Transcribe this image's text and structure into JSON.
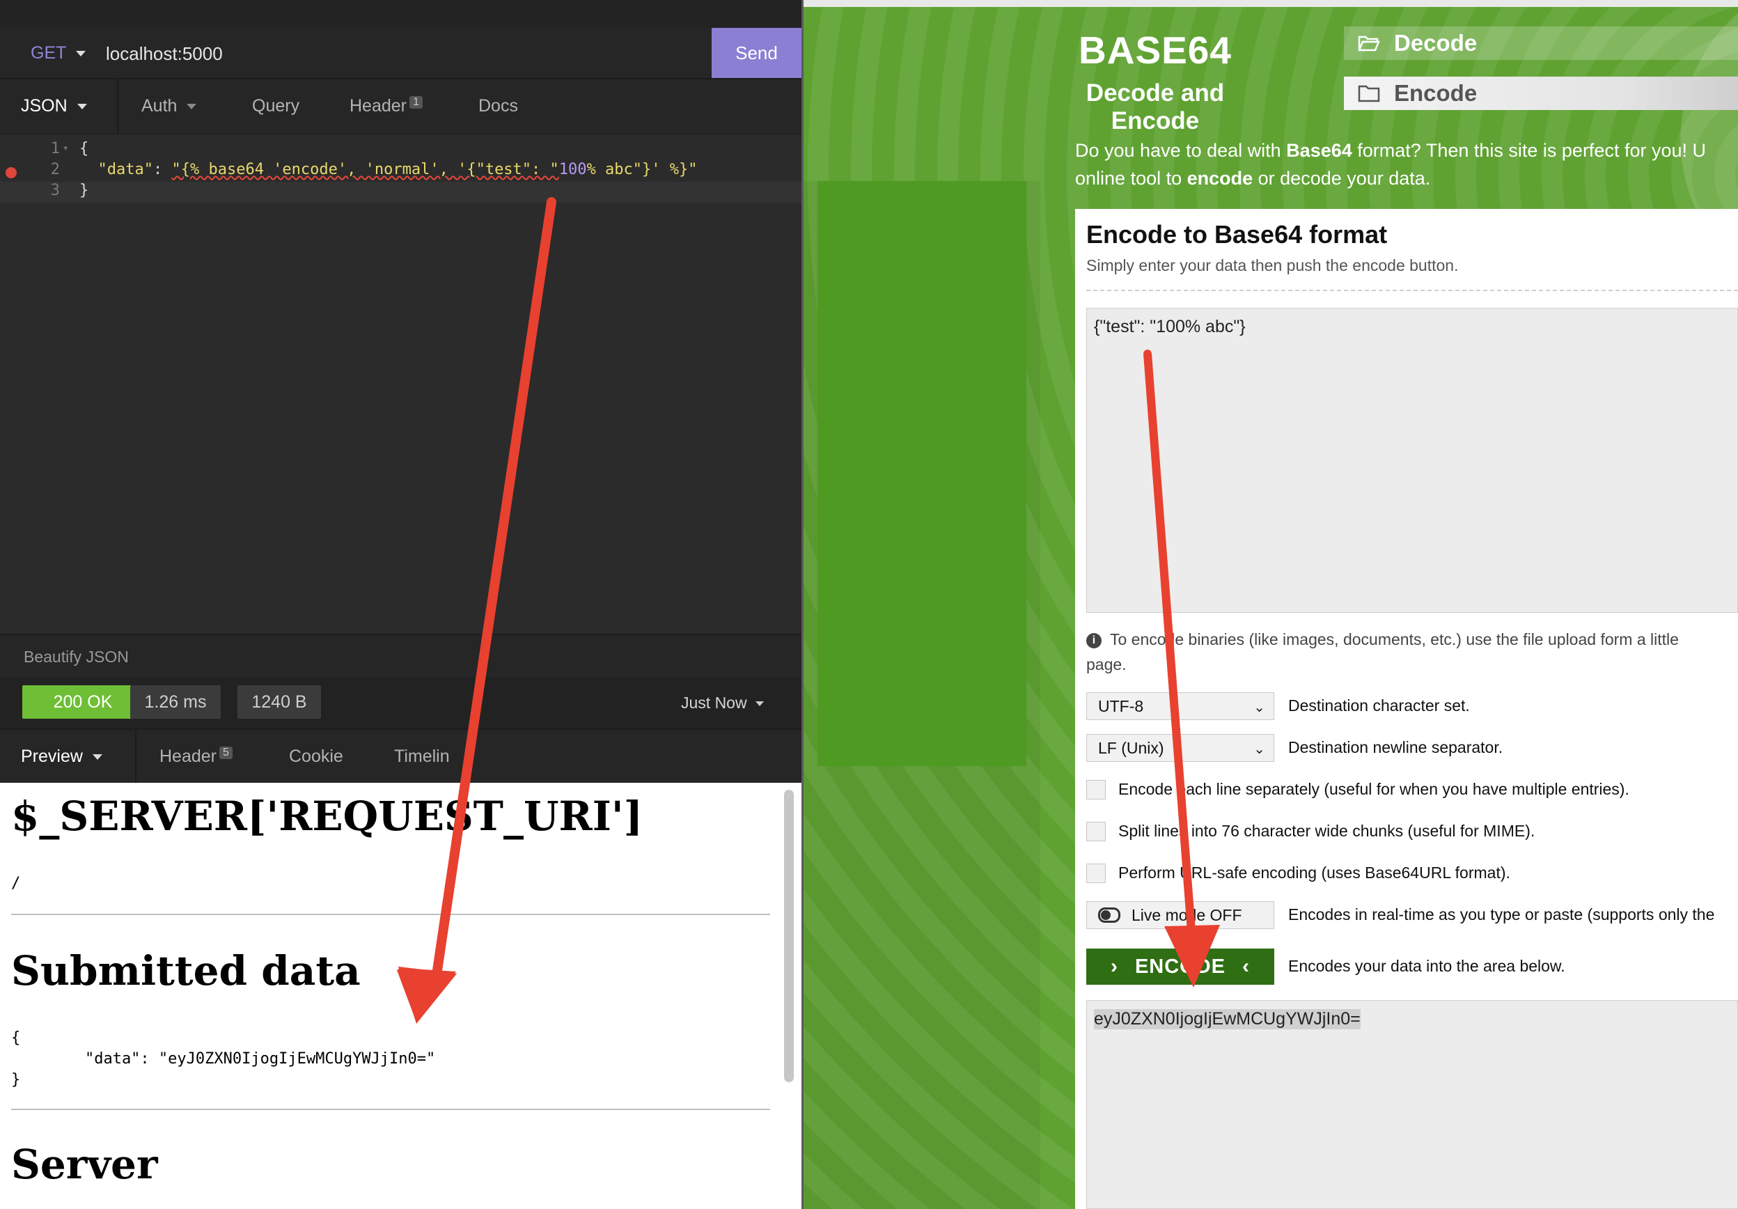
{
  "insomnia": {
    "method": "GET",
    "url": "localhost:5000",
    "send_label": "Send",
    "request_tabs": {
      "body": "JSON",
      "auth": "Auth",
      "query": "Query",
      "header": "Header",
      "header_count": "1",
      "docs": "Docs"
    },
    "editor": {
      "line_numbers": [
        "1",
        "2",
        "3"
      ],
      "line1": "{",
      "line2_key": "\"data\"",
      "line2_colon": ": ",
      "line2_val_a": "\"{% base64 'encode', 'normal', '{\"test\": \"",
      "line2_val_num": "100",
      "line2_val_b": "% abc\"}' %}\"",
      "line3": "}"
    },
    "beautify_label": "Beautify JSON",
    "status": {
      "code": "200 OK",
      "time": "1.26 ms",
      "size": "1240 B",
      "when": "Just Now"
    },
    "response_tabs": {
      "preview": "Preview",
      "header": "Header",
      "header_count": "5",
      "cookie": "Cookie",
      "timeline": "Timelin"
    },
    "preview": {
      "heading1": "$_SERVER['REQUEST_URI']",
      "uri_value": "/",
      "heading2": "Submitted data",
      "json_open": "{",
      "json_line": "        \"data\": \"eyJ0ZXN0IjogIjEwMCUgYWJjIn0=\"",
      "json_close": "}",
      "heading3": "Server"
    }
  },
  "site": {
    "brand_title": "BASE64",
    "brand_subtitle": "Decode and Encode",
    "nav_decode": "Decode",
    "nav_encode": "Encode",
    "intro_a": "Do you have to deal with ",
    "intro_b": "Base64",
    "intro_c": " format? Then this site is perfect for you! U",
    "intro_d": "online tool to ",
    "intro_e": "encode",
    "intro_f": " or decode your data.",
    "card_title": "Encode to Base64 format",
    "card_subtitle": "Simply enter your data then push the encode button.",
    "input_value": "{\"test\": \"100% abc\"}",
    "info_text": "To encode binaries (like images, documents, etc.) use the file upload form a little",
    "info_text2": "page.",
    "charset_value": "UTF-8",
    "charset_label": "Destination character set.",
    "newline_value": "LF (Unix)",
    "newline_label": "Destination newline separator.",
    "opt_each_line": "Encode each line separately (useful for when you have multiple entries).",
    "opt_split": "Split lines into 76 character wide chunks (useful for MIME).",
    "opt_urlsafe": "Perform URL-safe encoding (uses Base64URL format).",
    "live_mode": "Live mode OFF",
    "live_label": "Encodes in real-time as you type or paste (supports only the",
    "encode_button": "ENCODE",
    "encode_label": "Encodes your data into the area below.",
    "output_value": "eyJ0ZXN0IjogIjEwMCUgYWJjIn0="
  },
  "colors": {
    "accent_purple": "#8a7fd2",
    "status_ok": "#6fbf36",
    "site_green": "#5fa232",
    "encode_button": "#2f6e13",
    "arrow_red": "#e8412f"
  }
}
